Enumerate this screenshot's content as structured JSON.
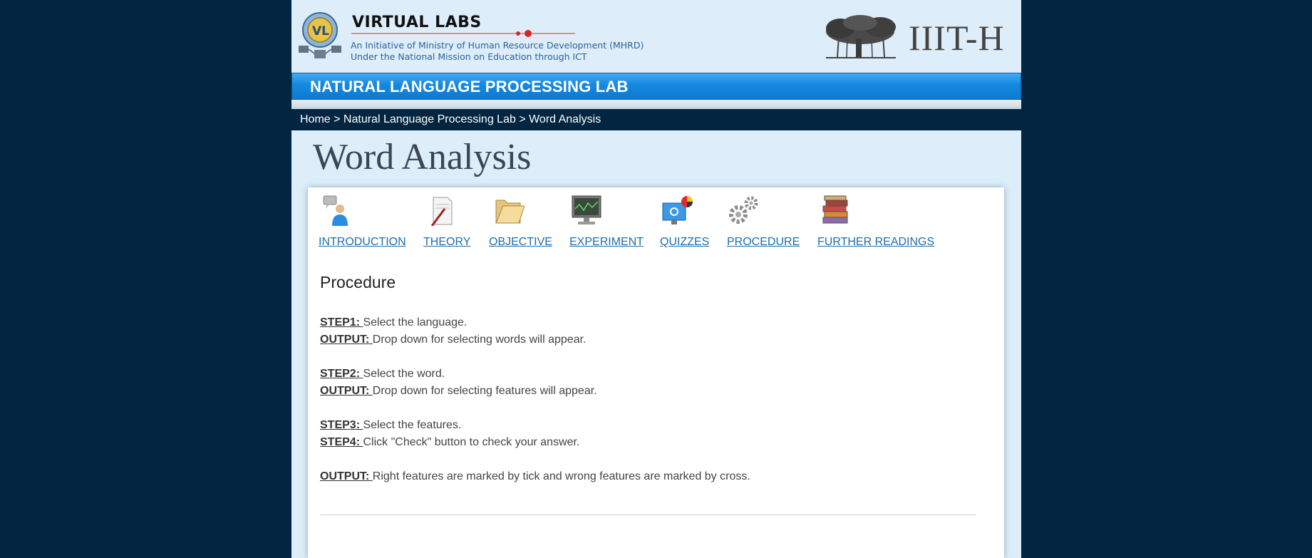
{
  "header": {
    "vl_title": "VIRTUAL LABS",
    "subtitle_line1": "An Initiative of Ministry of Human Resource Development (MHRD)",
    "subtitle_line2": "Under the National Mission on Education through ICT",
    "institute": "IIIT-H"
  },
  "lab": {
    "title": "NATURAL LANGUAGE PROCESSING LAB"
  },
  "breadcrumb": {
    "home": "Home",
    "sep1": " > ",
    "lab": "Natural Language Processing Lab",
    "sep2": " > ",
    "current": "Word Analysis"
  },
  "page": {
    "title": "Word Analysis"
  },
  "nav": {
    "items": [
      {
        "label": "INTRODUCTION",
        "icon": "person-speech-icon"
      },
      {
        "label": "THEORY",
        "icon": "document-pen-icon"
      },
      {
        "label": "OBJECTIVE",
        "icon": "folder-icon"
      },
      {
        "label": "EXPERIMENT",
        "icon": "monitor-icon"
      },
      {
        "label": "QUIZZES",
        "icon": "quiz-computer-icon"
      },
      {
        "label": "PROCEDURE",
        "icon": "gears-icon"
      },
      {
        "label": "FURTHER READINGS",
        "icon": "books-icon"
      }
    ]
  },
  "procedure": {
    "heading": "Procedure",
    "lines": [
      {
        "key": "STEP1: ",
        "text": "Select the language."
      },
      {
        "key": "OUTPUT: ",
        "text": "Drop down for selecting words will appear."
      },
      {
        "key": "STEP2: ",
        "text": "Select the word."
      },
      {
        "key": "OUTPUT: ",
        "text": "Drop down for selecting features will appear."
      },
      {
        "key": "STEP3: ",
        "text": "Select the features."
      },
      {
        "key": "STEP4: ",
        "text": "Click \"Check\" button to check your answer."
      },
      {
        "key": "OUTPUT: ",
        "text": "Right features are marked by tick and wrong features are marked by cross."
      }
    ]
  }
}
